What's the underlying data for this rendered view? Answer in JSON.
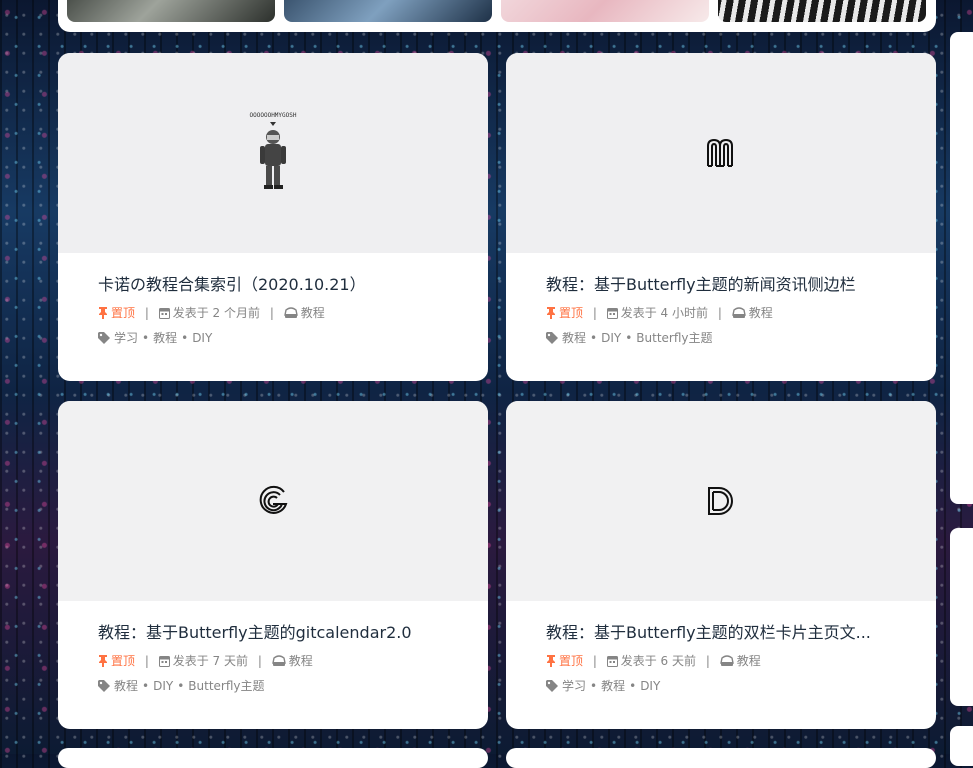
{
  "colors": {
    "sticky": "#ff7242",
    "meta": "#858585",
    "title": "#1f2d3d",
    "card": "#ffffff"
  },
  "icons": {
    "pin": "thumbtack-icon",
    "calendar": "calendar-icon",
    "category": "inbox-icon",
    "tag": "tag-icon"
  },
  "cards": [
    {
      "title": "卡诺の教程合集索引（2020.10.21）",
      "cover_caption": "OOOOOOHMYGOSH",
      "sticky": "置顶",
      "date": "发表于 2 个月前",
      "category": "教程",
      "tags": [
        "学习",
        "教程",
        "DIY"
      ]
    },
    {
      "title": "教程：基于Butterfly主题的新闻资讯侧边栏",
      "sticky": "置顶",
      "date": "发表于 4 小时前",
      "category": "教程",
      "tags": [
        "教程",
        "DIY",
        "Butterfly主题"
      ]
    },
    {
      "title": "教程：基于Butterfly主题的gitcalendar2.0",
      "sticky": "置顶",
      "date": "发表于 7 天前",
      "category": "教程",
      "tags": [
        "教程",
        "DIY",
        "Butterfly主题"
      ]
    },
    {
      "title": "教程：基于Butterfly主题的双栏卡片主页文...",
      "sticky": "置顶",
      "date": "发表于 6 天前",
      "category": "教程",
      "tags": [
        "学习",
        "教程",
        "DIY"
      ]
    }
  ]
}
